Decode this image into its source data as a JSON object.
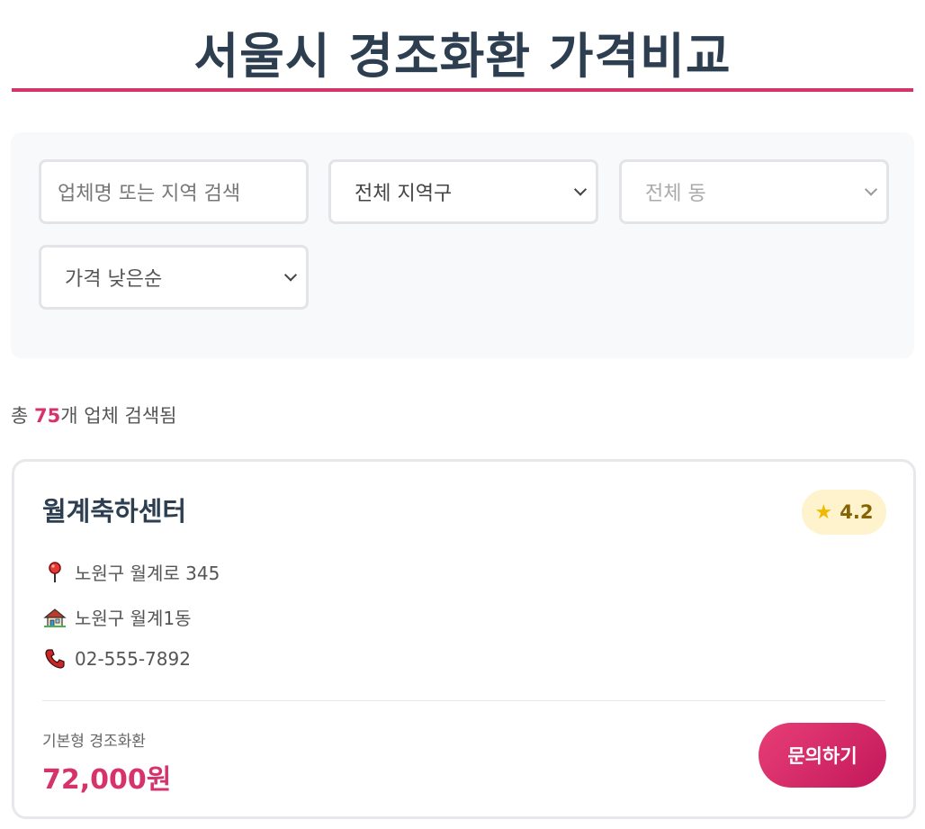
{
  "header": {
    "title": "서울시 경조화환 가격비교"
  },
  "filters": {
    "search_placeholder": "업체명 또는 지역 검색",
    "district_selected": "전체 지역구",
    "dong_selected": "전체 동",
    "sort_selected": "가격 낮은순"
  },
  "results": {
    "prefix": "총 ",
    "count": "75",
    "suffix": "개 업체 검색됨"
  },
  "card": {
    "name": "월계축하센터",
    "rating": "4.2",
    "address": "노원구 월계로 345",
    "dong": "노원구 월계1동",
    "phone": "02-555-7892",
    "service_label": "기본형 경조화환",
    "price": "72,000원",
    "inquire_label": "문의하기"
  },
  "colors": {
    "accent": "#d6336c",
    "title": "#2c3e50",
    "rating_bg": "#fff3cd",
    "star": "#f1b800"
  },
  "icons": {
    "address": "round-pushpin-icon",
    "dong": "house-icon",
    "phone": "telephone-receiver-icon",
    "rating": "star-icon",
    "dropdown": "chevron-down-icon"
  }
}
